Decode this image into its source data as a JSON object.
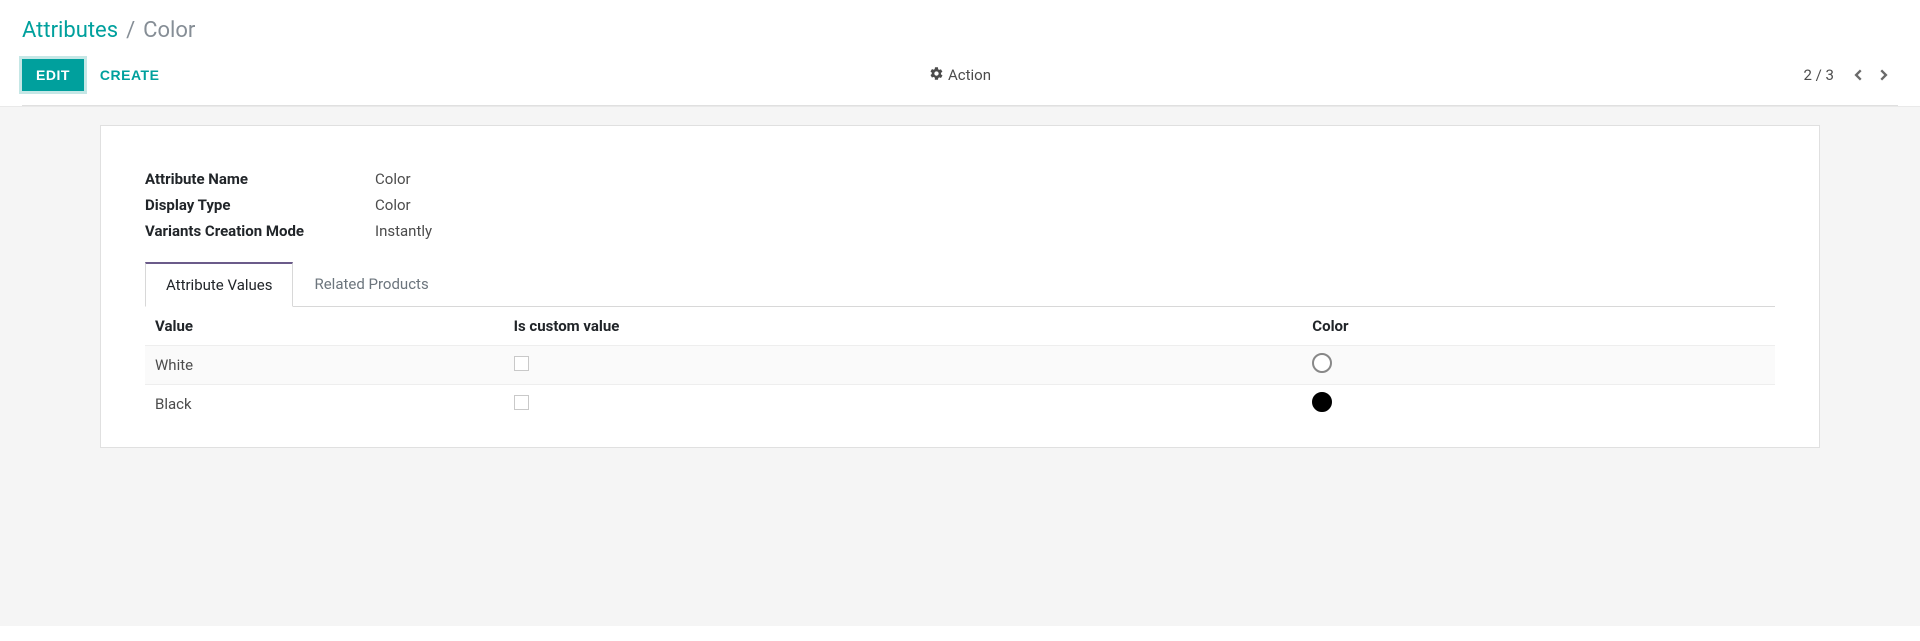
{
  "breadcrumb": {
    "root": "Attributes",
    "separator": "/",
    "current": "Color"
  },
  "toolbar": {
    "edit_label": "EDIT",
    "create_label": "CREATE",
    "action_label": "Action"
  },
  "pager": {
    "text": "2 / 3"
  },
  "form": {
    "fields": [
      {
        "label": "Attribute Name",
        "value": "Color"
      },
      {
        "label": "Display Type",
        "value": "Color"
      },
      {
        "label": "Variants Creation Mode",
        "value": "Instantly"
      }
    ]
  },
  "tabs": {
    "values_label": "Attribute Values",
    "related_label": "Related Products"
  },
  "table": {
    "headers": {
      "value": "Value",
      "is_custom": "Is custom value",
      "color": "Color"
    },
    "rows": [
      {
        "value": "White",
        "is_custom": false,
        "swatch": "swatch-white"
      },
      {
        "value": "Black",
        "is_custom": false,
        "swatch": "swatch-black"
      }
    ]
  }
}
